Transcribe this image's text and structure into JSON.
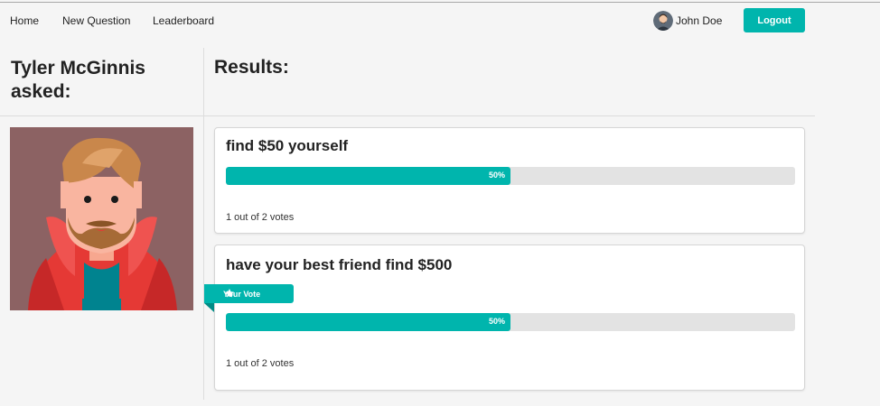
{
  "nav": {
    "links": [
      {
        "label": "Home"
      },
      {
        "label": "New Question"
      },
      {
        "label": "Leaderboard"
      }
    ],
    "user_name": "John Doe",
    "logout_label": "Logout"
  },
  "question": {
    "asked_by": "Tyler McGinnis asked:",
    "results_heading": "Results:"
  },
  "options": [
    {
      "text": "find $50 yourself",
      "percent_label": "50%",
      "percent": 50,
      "votes_text": "1 out of 2 votes",
      "is_user_vote": false
    },
    {
      "text": "have your best friend find $500",
      "percent_label": "50%",
      "percent": 50,
      "votes_text": "1 out of 2 votes",
      "is_user_vote": true
    }
  ],
  "your_vote_label": "Your Vote",
  "colors": {
    "accent": "#00b5ad",
    "bar_track": "#e3e3e3",
    "portrait_bg": "#8c6263"
  },
  "icons": {
    "vote_marker": "star-icon",
    "user_avatar": "avatar",
    "asker_avatar": "tyler-mcginnis-avatar"
  }
}
